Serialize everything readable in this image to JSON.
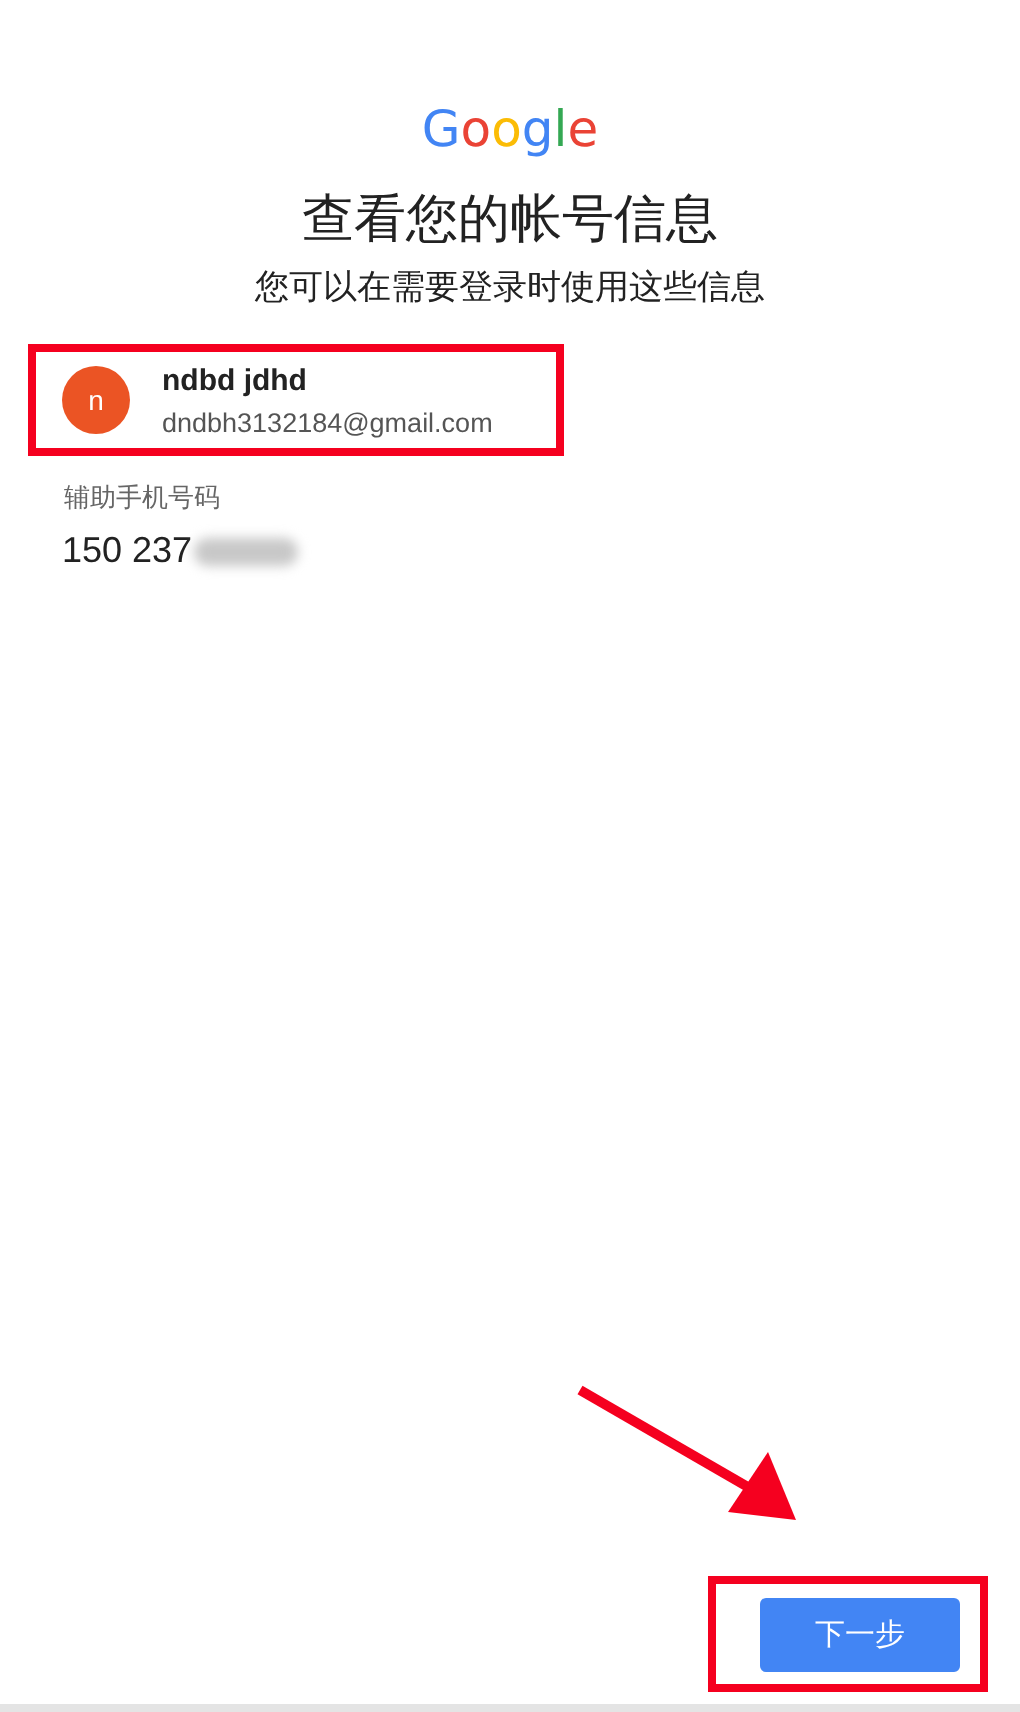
{
  "logo": "Google",
  "title": "查看您的帐号信息",
  "subtitle": "您可以在需要登录时使用这些信息",
  "account": {
    "initial": "n",
    "name": "ndbd jdhd",
    "email": "dndbh3132184@gmail.com"
  },
  "recovery_phone": {
    "label": "辅助手机号码",
    "value": "150 237"
  },
  "next_button": "下一步"
}
